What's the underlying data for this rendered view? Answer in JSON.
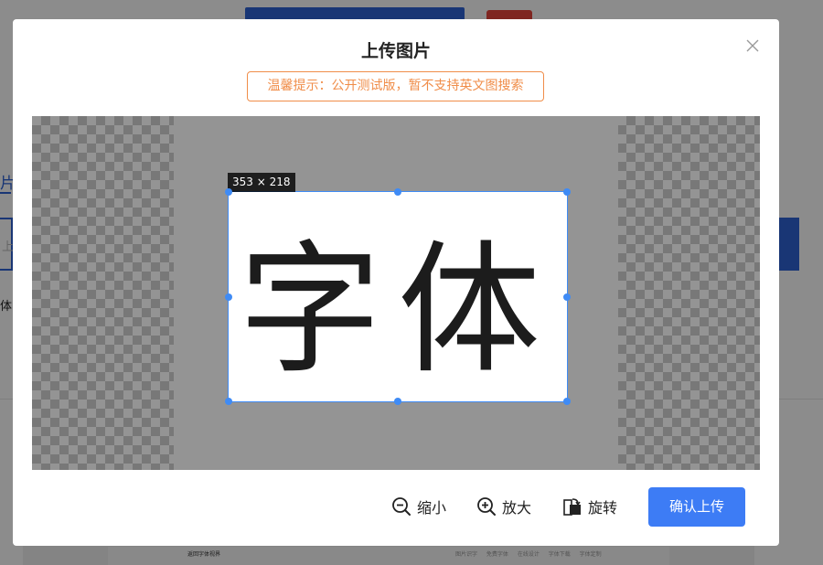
{
  "background": {
    "tab_label": "片",
    "input_placeholder": "上",
    "text": "体",
    "back_link": "返回字体视界",
    "footer_links": "图片识字 免费字体 在线设计 字体下载 字体定制"
  },
  "modal": {
    "title": "上传图片",
    "tip": "温馨提示：公开测试版，暂不支持英文图搜索",
    "close_icon": "close-icon",
    "crop": {
      "dimensions_label": "353 × 218",
      "image_text": "字体",
      "accent_color": "#3f8bf5"
    },
    "toolbar": {
      "zoom_out_label": "缩小",
      "zoom_in_label": "放大",
      "rotate_label": "旋转",
      "confirm_label": "确认上传"
    },
    "colors": {
      "tip": "#f08d49",
      "primary": "#3d7cf5"
    }
  }
}
